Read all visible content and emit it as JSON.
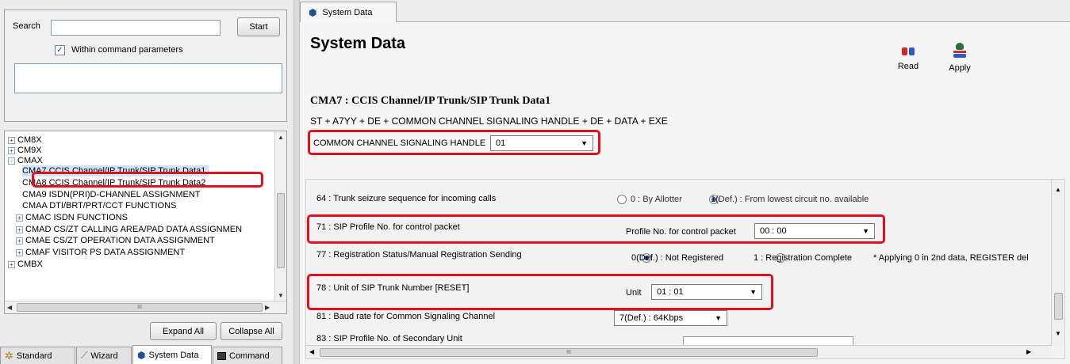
{
  "search": {
    "label": "Search",
    "value": "",
    "start_label": "Start",
    "within_label": "Within command parameters",
    "within_checked": true
  },
  "tree": {
    "nodes": [
      {
        "label": "CM8X",
        "expander": "+"
      },
      {
        "label": "CM9X",
        "expander": "+"
      },
      {
        "label": "CMAX",
        "expander": "-"
      },
      {
        "label": "CMA7 CCIS Channel/IP Trunk/SIP Trunk Data1",
        "expander": ""
      },
      {
        "label": "CMA8 CCIS Channel/IP Trunk/SIP Trunk Data2",
        "expander": ""
      },
      {
        "label": "CMA9 ISDN(PRI)D-CHANNEL ASSIGNMENT",
        "expander": ""
      },
      {
        "label": "CMAA DTI/BRT/PRT/CCT FUNCTIONS",
        "expander": ""
      },
      {
        "label": "CMAC ISDN FUNCTIONS",
        "expander": "+"
      },
      {
        "label": "CMAD CS/ZT CALLING AREA/PAD DATA ASSIGNMEN",
        "expander": "+"
      },
      {
        "label": "CMAE CS/ZT OPERATION DATA ASSIGNMENT",
        "expander": "+"
      },
      {
        "label": "CMAF VISITOR PS DATA ASSIGNMENT",
        "expander": "+"
      },
      {
        "label": "CMBX",
        "expander": "+"
      }
    ],
    "hscroll_grip": "III"
  },
  "buttons": {
    "expand_all": "Expand All",
    "collapse_all": "Collapse All"
  },
  "bottom_tabs": [
    {
      "label": "Standard"
    },
    {
      "label": "Wizard"
    },
    {
      "label": "System Data"
    },
    {
      "label": "Command"
    }
  ],
  "right": {
    "tab_label": "System Data",
    "title": "System Data",
    "read_label": "Read",
    "apply_label": "Apply",
    "command_title": "CMA7 : CCIS Channel/IP Trunk/SIP Trunk Data1",
    "command_syntax": "ST + A7YY + DE + COMMON CHANNEL SIGNALING HANDLE + DE + DATA + EXE",
    "handle_label": "COMMON CHANNEL SIGNALING HANDLE",
    "handle_value": "01",
    "rows": {
      "r64": {
        "label": "64 : Trunk seizure sequence for incoming calls",
        "opt0": "0 : By Allotter",
        "opt1": "1(Def.) : From lowest circuit no. available"
      },
      "r71": {
        "label": "71 : SIP Profile No. for control packet",
        "field_label": "Profile No. for control packet",
        "value": "00 : 00"
      },
      "r77": {
        "label": "77 : Registration Status/Manual Registration Sending",
        "opt0": "0(Def.) : Not Registered",
        "opt1": "1 : Registration Complete",
        "note": "* Applying 0 in 2nd data, REGISTER del"
      },
      "r78": {
        "label": "78 : Unit of SIP Trunk Number  [RESET]",
        "field_label": "Unit",
        "value": "01 : 01"
      },
      "r81": {
        "label": "81 : Baud rate for Common Signaling Channel",
        "value": "7(Def.) : 64Kbps"
      },
      "r83": {
        "label": "83 : SIP Profile No. of Secondary Unit"
      }
    },
    "hscroll_grip": "III"
  },
  "colors": {
    "highlight": "#e0101e",
    "selected_fill": "#cfe3fb"
  }
}
